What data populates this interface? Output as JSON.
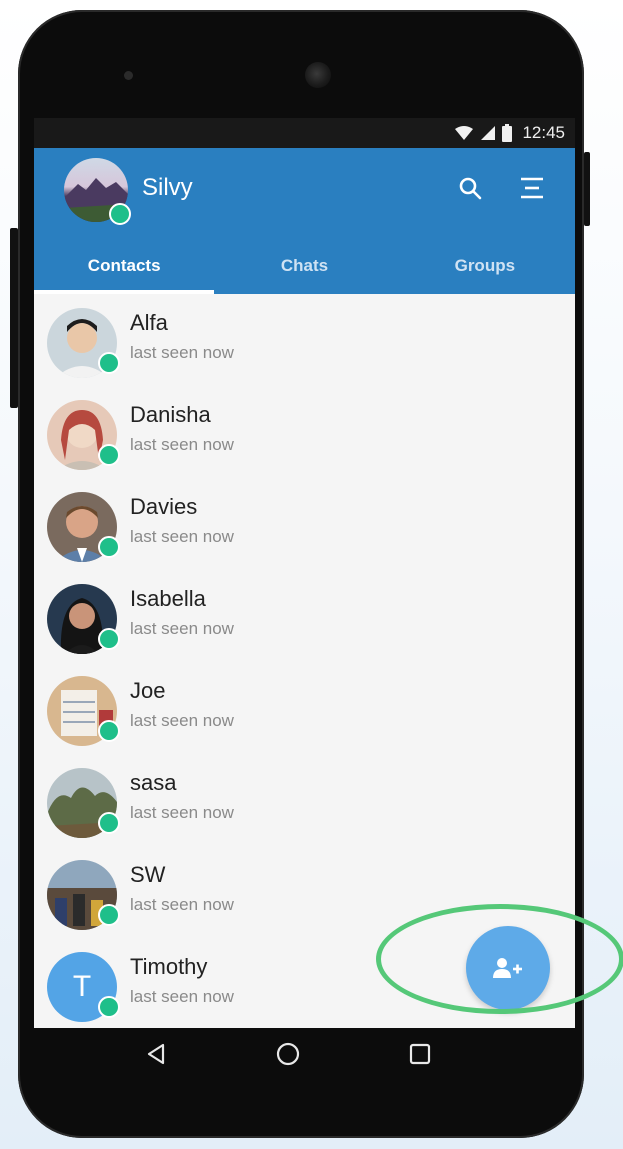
{
  "status_bar": {
    "time": "12:45",
    "icons": [
      "wifi-icon",
      "signal-icon",
      "battery-icon"
    ]
  },
  "header": {
    "user_name": "Silvy",
    "search_icon": "search-icon",
    "menu_icon": "menu-icon"
  },
  "tabs": [
    {
      "label": "Contacts",
      "active": true
    },
    {
      "label": "Chats",
      "active": false
    },
    {
      "label": "Groups",
      "active": false
    }
  ],
  "contacts": [
    {
      "name": "Alfa",
      "status": "last seen now"
    },
    {
      "name": "Danisha",
      "status": "last seen now"
    },
    {
      "name": "Davies",
      "status": "last seen now"
    },
    {
      "name": "Isabella",
      "status": "last seen now"
    },
    {
      "name": "Joe",
      "status": "last seen now"
    },
    {
      "name": "sasa",
      "status": "last seen now"
    },
    {
      "name": "SW",
      "status": "last seen now"
    },
    {
      "name": "Timothy",
      "status": "last seen now",
      "initial": "T"
    }
  ],
  "fab": {
    "icon": "add-contact-icon"
  },
  "nav_keys": [
    "back-icon",
    "home-icon",
    "recents-icon"
  ],
  "colors": {
    "app_bar": "#2a7fc0",
    "fab": "#5eaae8",
    "online": "#1fbf8a",
    "highlight": "#55c878"
  }
}
